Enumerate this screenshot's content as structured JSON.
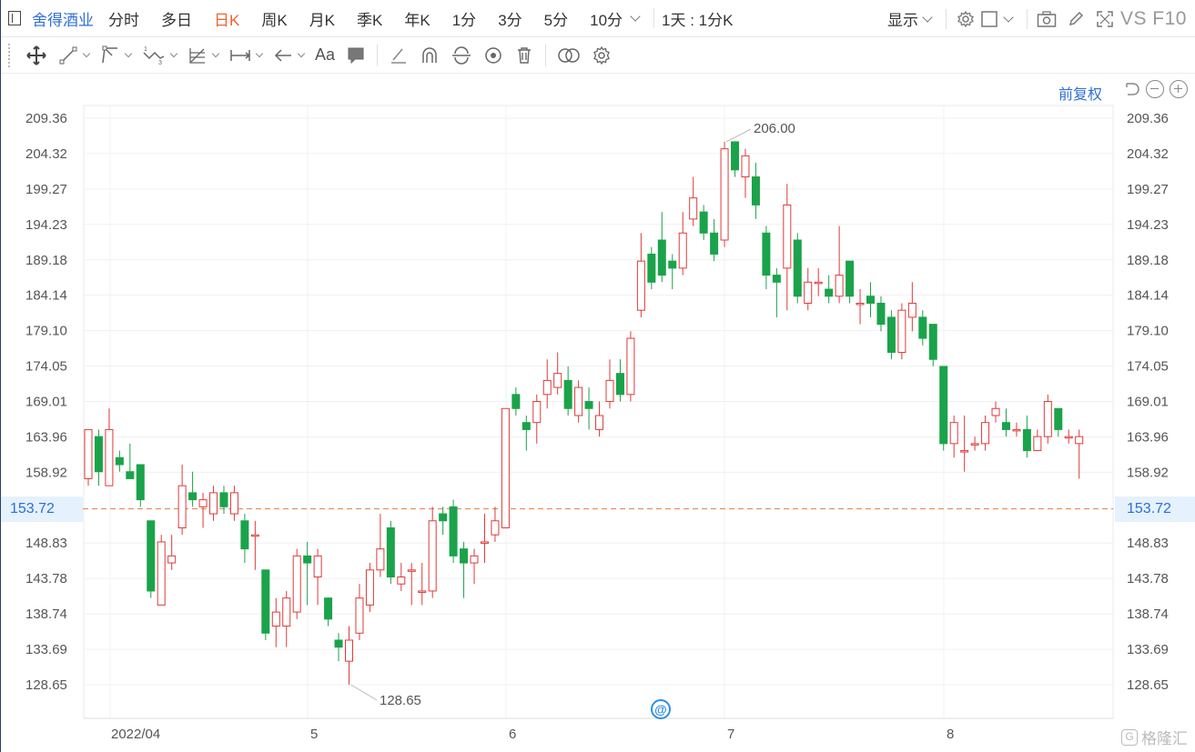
{
  "header": {
    "stock_name": "舍得酒业",
    "tabs": [
      "分时",
      "多日",
      "日K",
      "周K",
      "月K",
      "季K",
      "年K",
      "1分",
      "3分",
      "5分",
      "10分"
    ],
    "active_tab": "日K",
    "period_select": "1天 : 1分K",
    "display_label": "显示",
    "vs_f10": "VS F10"
  },
  "toolbar": {
    "icons": [
      "move-icon",
      "line-segment-icon",
      "channel-icon",
      "wave-icon",
      "fibonacci-icon",
      "range-icon",
      "arrow-icon"
    ],
    "text_tool": "Aa",
    "more_icons": [
      "comment-icon",
      "pen-icon",
      "arc-icon",
      "cycle-icon",
      "eye-icon",
      "trash-icon",
      "overlay-icon",
      "settings-icon"
    ]
  },
  "subheader": {
    "adjust_label": "前复权"
  },
  "axis": {
    "y_ticks": [
      "209.36",
      "204.32",
      "199.27",
      "194.23",
      "189.18",
      "184.14",
      "179.10",
      "174.05",
      "169.01",
      "163.96",
      "158.92",
      "153.72",
      "148.83",
      "143.78",
      "138.74",
      "133.69",
      "128.65"
    ],
    "x_labels": [
      "2022/04",
      "5",
      "6",
      "7",
      "8"
    ]
  },
  "current_price": "153.72",
  "annotations": {
    "high": "206.00",
    "low": "128.65"
  },
  "watermark": "格隆汇",
  "colors": {
    "up": "#e03a3a",
    "down": "#1aa34a",
    "accent": "#2f6fd6",
    "active_tab": "#f0622e",
    "price_line": "#e8905a"
  },
  "chart_data": {
    "type": "candlestick",
    "ylim": [
      126.5,
      211.5
    ],
    "price_line": 153.72,
    "high_label": 206.0,
    "low_label": 128.65,
    "candles": [
      {
        "o": 158,
        "c": 165,
        "h": 165,
        "l": 157
      },
      {
        "o": 164,
        "c": 159,
        "h": 165,
        "l": 157
      },
      {
        "o": 157,
        "c": 165,
        "h": 168,
        "l": 157
      },
      {
        "o": 161,
        "c": 160,
        "h": 162,
        "l": 159
      },
      {
        "o": 159,
        "c": 158,
        "h": 163,
        "l": 158
      },
      {
        "o": 160,
        "c": 155,
        "h": 160,
        "l": 154
      },
      {
        "o": 152,
        "c": 142,
        "h": 152,
        "l": 141
      },
      {
        "o": 140,
        "c": 149,
        "h": 150,
        "l": 140
      },
      {
        "o": 146,
        "c": 147,
        "h": 150,
        "l": 145
      },
      {
        "o": 151,
        "c": 157,
        "h": 160,
        "l": 150
      },
      {
        "o": 156,
        "c": 155,
        "h": 159,
        "l": 154
      },
      {
        "o": 154,
        "c": 155,
        "h": 156,
        "l": 151
      },
      {
        "o": 153,
        "c": 156,
        "h": 157,
        "l": 152
      },
      {
        "o": 156,
        "c": 154,
        "h": 157,
        "l": 153
      },
      {
        "o": 153,
        "c": 156,
        "h": 157,
        "l": 152
      },
      {
        "o": 152,
        "c": 148,
        "h": 153,
        "l": 146
      },
      {
        "o": 150,
        "c": 150,
        "h": 152,
        "l": 145
      },
      {
        "o": 145,
        "c": 136,
        "h": 145,
        "l": 135
      },
      {
        "o": 137,
        "c": 139,
        "h": 141,
        "l": 134
      },
      {
        "o": 137,
        "c": 141,
        "h": 142,
        "l": 134
      },
      {
        "o": 139,
        "c": 147,
        "h": 148,
        "l": 138
      },
      {
        "o": 147,
        "c": 146,
        "h": 149,
        "l": 140
      },
      {
        "o": 144,
        "c": 147,
        "h": 148,
        "l": 140
      },
      {
        "o": 141,
        "c": 138,
        "h": 141,
        "l": 137
      },
      {
        "o": 135,
        "c": 134,
        "h": 136,
        "l": 132
      },
      {
        "o": 132,
        "c": 135,
        "h": 137,
        "l": 128.65
      },
      {
        "o": 136,
        "c": 141,
        "h": 143,
        "l": 135
      },
      {
        "o": 140,
        "c": 145,
        "h": 146,
        "l": 139
      },
      {
        "o": 145,
        "c": 148,
        "h": 153,
        "l": 144
      },
      {
        "o": 151,
        "c": 144,
        "h": 152,
        "l": 143
      },
      {
        "o": 143,
        "c": 144,
        "h": 146,
        "l": 142
      },
      {
        "o": 145,
        "c": 145,
        "h": 146,
        "l": 140
      },
      {
        "o": 142,
        "c": 142,
        "h": 146,
        "l": 140
      },
      {
        "o": 142,
        "c": 152,
        "h": 154,
        "l": 141
      },
      {
        "o": 153,
        "c": 152,
        "h": 154,
        "l": 150
      },
      {
        "o": 154,
        "c": 147,
        "h": 155,
        "l": 146
      },
      {
        "o": 148,
        "c": 146,
        "h": 149,
        "l": 141
      },
      {
        "o": 146,
        "c": 147,
        "h": 148,
        "l": 143
      },
      {
        "o": 149,
        "c": 149,
        "h": 153,
        "l": 146
      },
      {
        "o": 150,
        "c": 152,
        "h": 154,
        "l": 149
      },
      {
        "o": 151,
        "c": 168,
        "h": 168,
        "l": 151
      },
      {
        "o": 170,
        "c": 168,
        "h": 171,
        "l": 167
      },
      {
        "o": 166,
        "c": 165,
        "h": 167,
        "l": 162
      },
      {
        "o": 166,
        "c": 169,
        "h": 170,
        "l": 163
      },
      {
        "o": 170,
        "c": 172,
        "h": 175,
        "l": 168
      },
      {
        "o": 171,
        "c": 173,
        "h": 176,
        "l": 170
      },
      {
        "o": 172,
        "c": 168,
        "h": 174,
        "l": 167
      },
      {
        "o": 167,
        "c": 171,
        "h": 172,
        "l": 166
      },
      {
        "o": 169,
        "c": 168,
        "h": 171,
        "l": 165
      },
      {
        "o": 165,
        "c": 167,
        "h": 169,
        "l": 164
      },
      {
        "o": 169,
        "c": 172,
        "h": 175,
        "l": 168
      },
      {
        "o": 173,
        "c": 170,
        "h": 175,
        "l": 169
      },
      {
        "o": 170,
        "c": 178,
        "h": 179,
        "l": 169
      },
      {
        "o": 182,
        "c": 189,
        "h": 193,
        "l": 181
      },
      {
        "o": 190,
        "c": 186,
        "h": 191,
        "l": 185
      },
      {
        "o": 192,
        "c": 187,
        "h": 196,
        "l": 186
      },
      {
        "o": 189,
        "c": 188,
        "h": 190,
        "l": 185
      },
      {
        "o": 188,
        "c": 193,
        "h": 196,
        "l": 187
      },
      {
        "o": 195,
        "c": 198,
        "h": 201,
        "l": 194
      },
      {
        "o": 196,
        "c": 193,
        "h": 197,
        "l": 192
      },
      {
        "o": 193,
        "c": 190,
        "h": 195,
        "l": 189
      },
      {
        "o": 192,
        "c": 205,
        "h": 206,
        "l": 191
      },
      {
        "o": 206,
        "c": 202,
        "h": 206,
        "l": 201
      },
      {
        "o": 201,
        "c": 204,
        "h": 205,
        "l": 198
      },
      {
        "o": 201,
        "c": 197,
        "h": 203,
        "l": 195
      },
      {
        "o": 193,
        "c": 187,
        "h": 194,
        "l": 185
      },
      {
        "o": 187,
        "c": 186,
        "h": 188,
        "l": 181
      },
      {
        "o": 188,
        "c": 197,
        "h": 200,
        "l": 182
      },
      {
        "o": 192,
        "c": 184,
        "h": 193,
        "l": 183
      },
      {
        "o": 183,
        "c": 186,
        "h": 188,
        "l": 182
      },
      {
        "o": 186,
        "c": 186,
        "h": 188,
        "l": 184
      },
      {
        "o": 185,
        "c": 184,
        "h": 187,
        "l": 183
      },
      {
        "o": 184,
        "c": 187,
        "h": 194,
        "l": 183
      },
      {
        "o": 189,
        "c": 184,
        "h": 189,
        "l": 183
      },
      {
        "o": 183,
        "c": 183,
        "h": 185,
        "l": 180
      },
      {
        "o": 184,
        "c": 183,
        "h": 186,
        "l": 181
      },
      {
        "o": 183,
        "c": 180,
        "h": 184,
        "l": 179
      },
      {
        "o": 181,
        "c": 176,
        "h": 182,
        "l": 175
      },
      {
        "o": 176,
        "c": 182,
        "h": 183,
        "l": 175
      },
      {
        "o": 181,
        "c": 183,
        "h": 186,
        "l": 179
      },
      {
        "o": 181,
        "c": 178,
        "h": 182,
        "l": 177
      },
      {
        "o": 180,
        "c": 175,
        "h": 180,
        "l": 174
      },
      {
        "o": 174,
        "c": 163,
        "h": 174,
        "l": 162
      },
      {
        "o": 163,
        "c": 166,
        "h": 167,
        "l": 161
      },
      {
        "o": 162,
        "c": 162,
        "h": 167,
        "l": 159
      },
      {
        "o": 163,
        "c": 163,
        "h": 164,
        "l": 162
      },
      {
        "o": 163,
        "c": 166,
        "h": 167,
        "l": 162
      },
      {
        "o": 167,
        "c": 168,
        "h": 169,
        "l": 166
      },
      {
        "o": 166,
        "c": 165,
        "h": 168,
        "l": 164
      },
      {
        "o": 165,
        "c": 165,
        "h": 166,
        "l": 164
      },
      {
        "o": 165,
        "c": 162,
        "h": 167,
        "l": 161
      },
      {
        "o": 162,
        "c": 164,
        "h": 165,
        "l": 162
      },
      {
        "o": 164,
        "c": 169,
        "h": 170,
        "l": 163
      },
      {
        "o": 168,
        "c": 165,
        "h": 168,
        "l": 164
      },
      {
        "o": 164,
        "c": 164,
        "h": 165,
        "l": 163
      },
      {
        "o": 163,
        "c": 164,
        "h": 165,
        "l": 158
      }
    ]
  }
}
